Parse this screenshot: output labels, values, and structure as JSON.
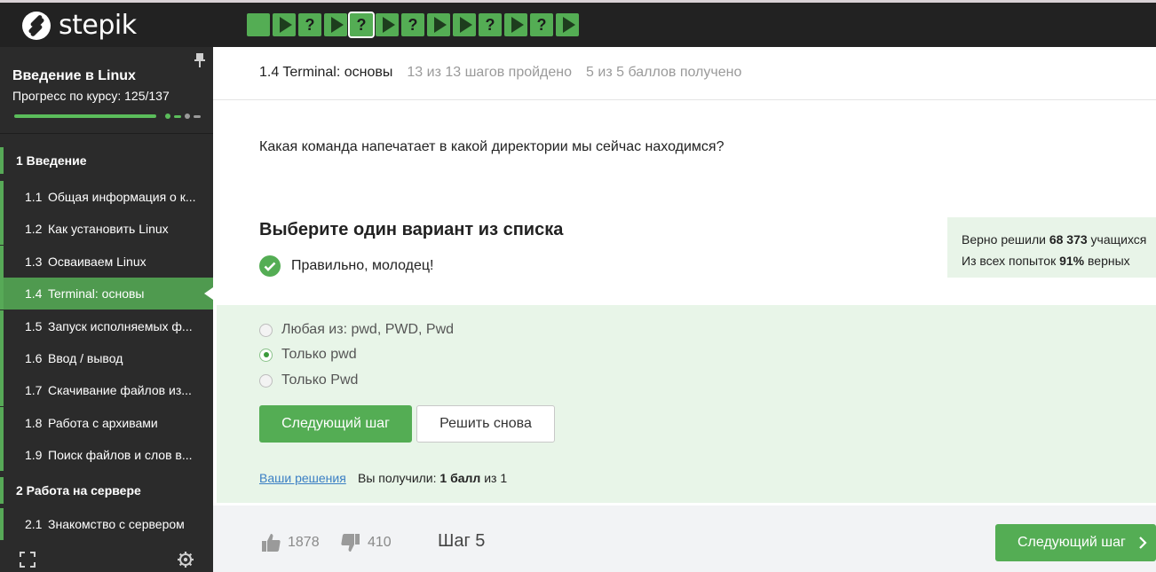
{
  "brand": {
    "name": "stepik"
  },
  "topbar": {
    "steps": [
      {
        "type": "square"
      },
      {
        "type": "play"
      },
      {
        "type": "quiz",
        "label": "?"
      },
      {
        "type": "play"
      },
      {
        "type": "quiz",
        "label": "?",
        "active": true
      },
      {
        "type": "play"
      },
      {
        "type": "quiz",
        "label": "?"
      },
      {
        "type": "play"
      },
      {
        "type": "play"
      },
      {
        "type": "quiz",
        "label": "?"
      },
      {
        "type": "play"
      },
      {
        "type": "quiz",
        "label": "?"
      },
      {
        "type": "play"
      }
    ]
  },
  "sidebar": {
    "course_title": "Введение в Linux",
    "progress_label": "Прогресс по курсу:  125/137",
    "progress_fraction": 0.912,
    "sections": [
      {
        "title": "1  Введение",
        "lessons": [
          {
            "num": "1.1",
            "title": "Общая информация о к..."
          },
          {
            "num": "1.2",
            "title": "Как установить Linux"
          },
          {
            "num": "1.3",
            "title": "Осваиваем Linux"
          },
          {
            "num": "1.4",
            "title": "Terminal: основы",
            "active": true
          },
          {
            "num": "1.5",
            "title": "Запуск исполняемых ф..."
          },
          {
            "num": "1.6",
            "title": "Ввод / вывод"
          },
          {
            "num": "1.7",
            "title": "Скачивание файлов из..."
          },
          {
            "num": "1.8",
            "title": "Работа с архивами"
          },
          {
            "num": "1.9",
            "title": "Поиск файлов и слов в..."
          }
        ]
      },
      {
        "title": "2  Работа на сервере",
        "lessons": [
          {
            "num": "2.1",
            "title": "Знакомство с сервером"
          }
        ]
      }
    ]
  },
  "header": {
    "lesson": "1.4 Terminal: основы",
    "steps_done": "13 из 13 шагов пройдено",
    "points": "5 из 5 баллов  получено"
  },
  "quiz": {
    "question": "Какая команда напечатает в какой директории мы сейчас находимся?",
    "instruction": "Выберите один вариант из списка",
    "feedback": "Правильно, молодец!",
    "stats_line1_pre": "Верно решили ",
    "stats_line1_num": "68 373",
    "stats_line1_post": " учащихся",
    "stats_line2_pre": "Из всех попыток ",
    "stats_line2_num": "91%",
    "stats_line2_post": " верных",
    "options": [
      {
        "label": "Любая из: pwd, PWD, Pwd",
        "selected": false
      },
      {
        "label": "Только pwd",
        "selected": true
      },
      {
        "label": "Только Pwd",
        "selected": false
      }
    ],
    "next_label": "Следующий шаг",
    "retry_label": "Решить снова",
    "solutions_link": "Ваши решения",
    "score_pre": "Вы получили: ",
    "score_value": "1 балл",
    "score_post": " из 1"
  },
  "footer": {
    "likes": "1878",
    "dislikes": "410",
    "step_label": "Шаг 5",
    "next_label": "Следующий шаг"
  },
  "colors": {
    "accent": "#54ad54",
    "topbar": "#222222",
    "sidebar": "#2b2b2b",
    "answer_bg": "#e8f5e8"
  }
}
